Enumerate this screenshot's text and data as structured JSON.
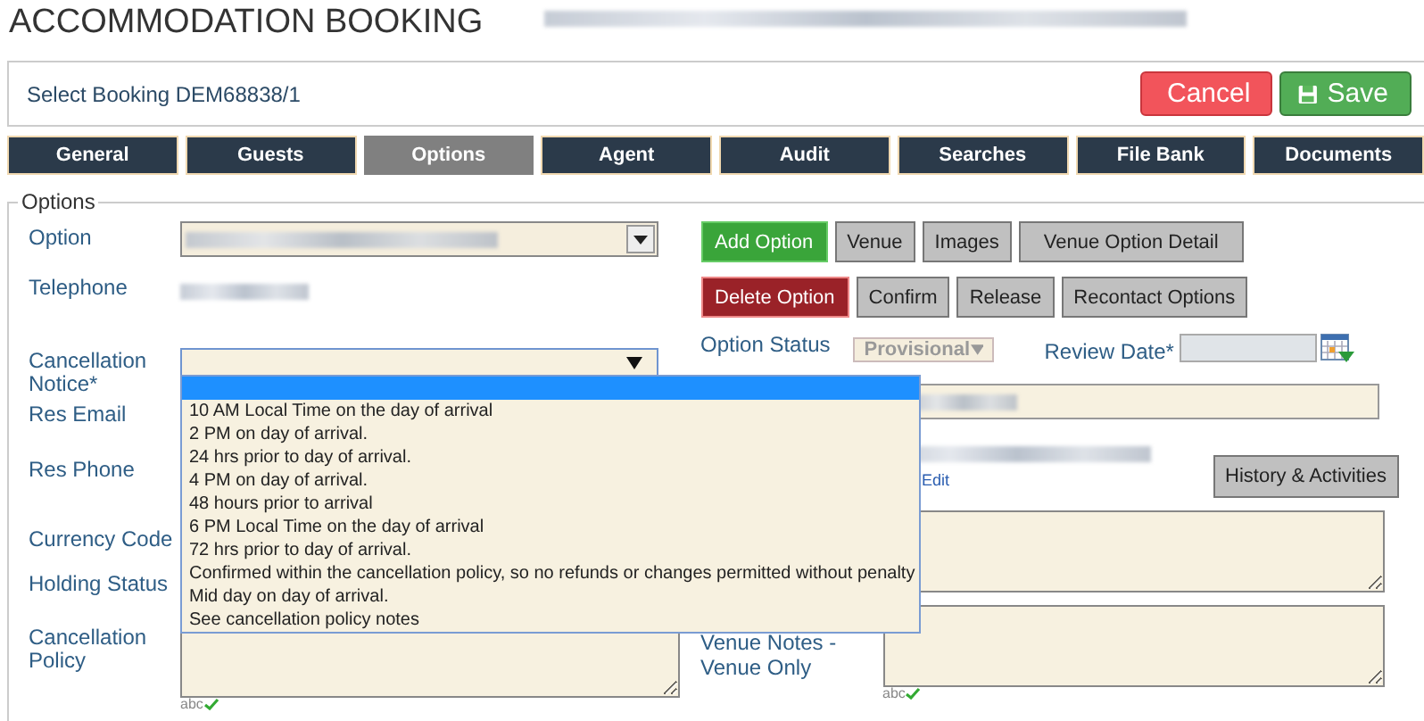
{
  "page_title": "ACCOMMODATION BOOKING",
  "booking": {
    "label": "Select Booking DEM68838/1"
  },
  "actions": [
    {
      "label": "Cancel",
      "kind": "danger"
    },
    {
      "label": "Save",
      "kind": "success"
    }
  ],
  "tabs": [
    {
      "label": "General",
      "selected": false
    },
    {
      "label": "Guests",
      "selected": false
    },
    {
      "label": "Options",
      "selected": true
    },
    {
      "label": "Agent",
      "selected": false
    },
    {
      "label": "Audit",
      "selected": false
    },
    {
      "label": "Searches",
      "selected": false
    },
    {
      "label": "File Bank",
      "selected": false
    },
    {
      "label": "Documents",
      "selected": false
    }
  ],
  "fieldset": {
    "legend": "Options"
  },
  "left_fields": [
    {
      "label": "Option",
      "kind": "select"
    },
    {
      "label": "Telephone",
      "kind": "value"
    },
    {
      "label": "Cancellation Notice*",
      "kind": "open-select"
    },
    {
      "label": "Res Email",
      "kind": "blank"
    },
    {
      "label": "Res Phone",
      "kind": "blank"
    },
    {
      "label": "Currency Code",
      "kind": "blank"
    },
    {
      "label": "Holding Status",
      "kind": "blank"
    },
    {
      "label": "Cancellation Policy",
      "kind": "textarea",
      "spellcheck": "abc"
    }
  ],
  "option_buttons": [
    [
      {
        "label": "Add Option",
        "kind": "success"
      },
      {
        "label": "Venue",
        "kind": "default"
      },
      {
        "label": "Images",
        "kind": "default"
      },
      {
        "label": "Venue Option Detail",
        "kind": "default"
      }
    ],
    [
      {
        "label": "Delete Option",
        "kind": "danger"
      },
      {
        "label": "Confirm",
        "kind": "default"
      },
      {
        "label": "Release",
        "kind": "default"
      },
      {
        "label": "Recontact Options",
        "kind": "default"
      }
    ]
  ],
  "option_status": {
    "label": "Option Status",
    "value": "Provisional",
    "disabled": true
  },
  "review_date": {
    "label": "Review Date*"
  },
  "res_phone": {
    "link": "Edit",
    "button": "History & Activities"
  },
  "venue_notes": {
    "label_line_1": "Venue Notes -",
    "label_line_2": "Venue Only",
    "spellcheck": "abc"
  },
  "dropdown": {
    "blank_option_selected": true,
    "options": [
      "10 AM Local Time on the day of arrival",
      "2 PM on day of arrival.",
      "24 hrs prior to day of arrival.",
      "4 PM on day of arrival.",
      "48 hours prior to arrival",
      "6 PM Local Time on the day of arrival",
      "72 hrs prior to day of arrival.",
      "Confirmed within the cancellation policy, so no refunds or changes permitted without penalty",
      "Mid day on day of arrival.",
      "See cancellation policy notes"
    ]
  }
}
